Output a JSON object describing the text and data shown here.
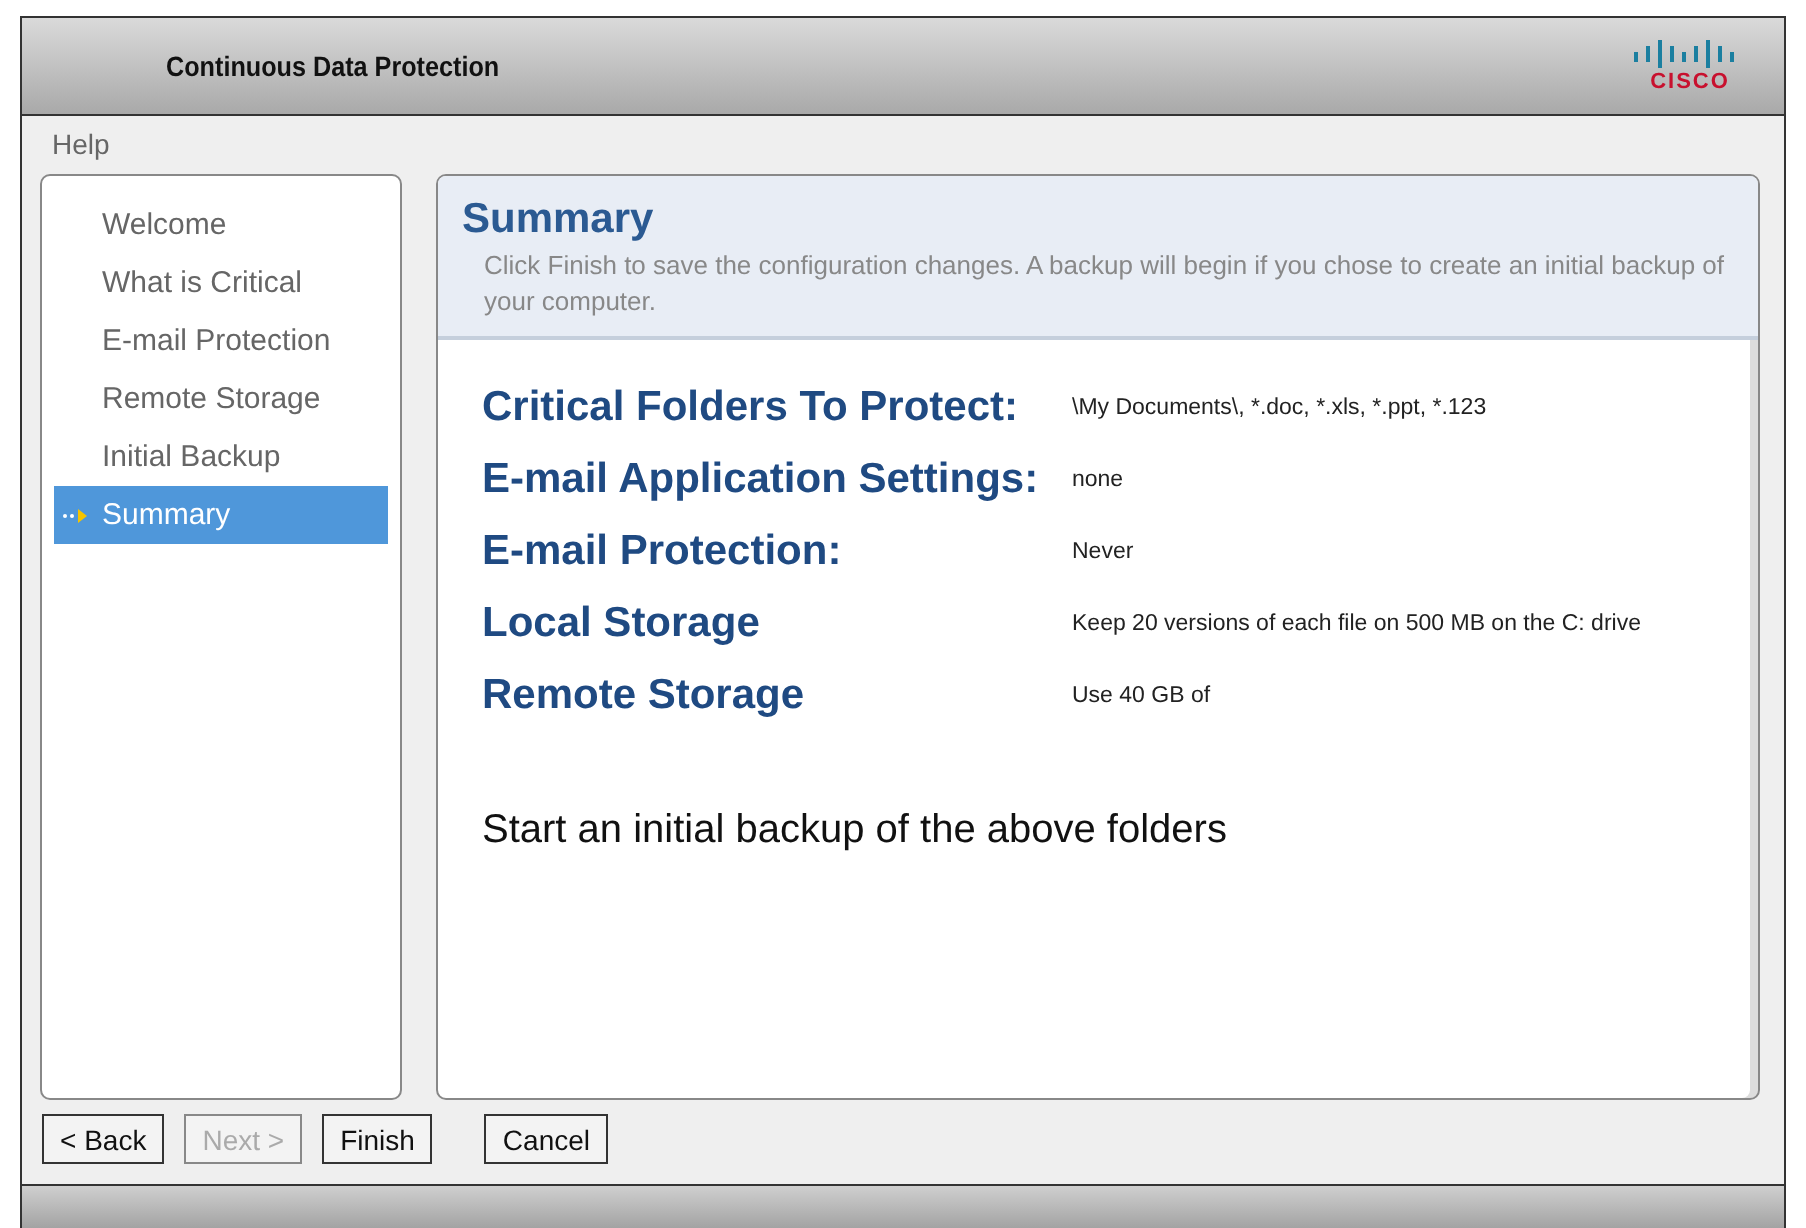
{
  "window": {
    "title": "Continuous Data Protection",
    "logo": "CISCO"
  },
  "menu": [
    "Help"
  ],
  "sidebar": {
    "items": [
      {
        "label": "Welcome",
        "selected": false
      },
      {
        "label": "What is Critical",
        "selected": false
      },
      {
        "label": "E-mail Protection",
        "selected": false
      },
      {
        "label": "Remote Storage",
        "selected": false
      },
      {
        "label": "Initial Backup",
        "selected": false
      },
      {
        "label": "Summary",
        "selected": true
      }
    ]
  },
  "content": {
    "title": "Summary",
    "description": "Click Finish to save the configuration changes. A backup will begin if you chose to create an initial backup of your computer.",
    "rows": [
      {
        "label": "Critical Folders To Protect:",
        "value": "\\My Documents\\, *.doc, *.xls, *.ppt, *.123"
      },
      {
        "label": "E-mail Application Settings:",
        "value": "none"
      },
      {
        "label": "E-mail Protection:",
        "value": "Never"
      },
      {
        "label": "Local Storage",
        "value": "Keep 20 versions of each file on 500 MB on the C: drive"
      },
      {
        "label": "Remote Storage",
        "value": "Use 40 GB of"
      }
    ],
    "note": "Start an initial backup of the above folders"
  },
  "buttons": [
    {
      "label": "< Back",
      "disabled": false
    },
    {
      "label": "Next >",
      "disabled": true
    },
    {
      "label": "Finish",
      "disabled": false
    },
    {
      "label": "Cancel",
      "disabled": false
    }
  ]
}
